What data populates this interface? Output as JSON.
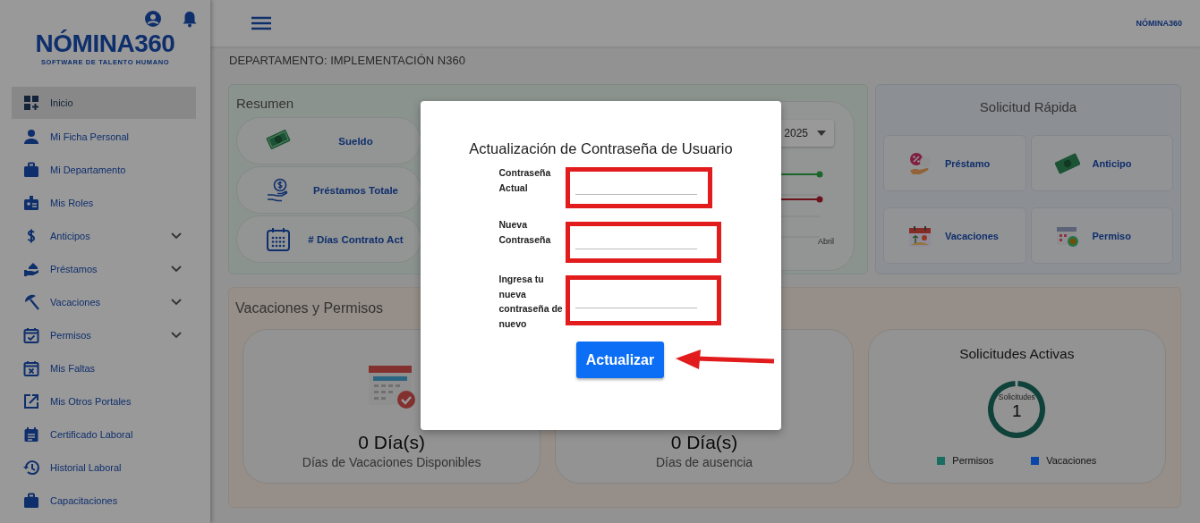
{
  "sidebar": {
    "logo": {
      "name": "NÓMINA360",
      "tagline": "SOFTWARE DE TALENTO HUMANO"
    },
    "items": [
      {
        "label": "Inicio",
        "selected": true,
        "has_submenu": false
      },
      {
        "label": "Mi Ficha Personal",
        "selected": false,
        "has_submenu": false
      },
      {
        "label": "Mi Departamento",
        "selected": false,
        "has_submenu": false
      },
      {
        "label": "Mis Roles",
        "selected": false,
        "has_submenu": false
      },
      {
        "label": "Anticipos",
        "selected": false,
        "has_submenu": true
      },
      {
        "label": "Préstamos",
        "selected": false,
        "has_submenu": true
      },
      {
        "label": "Vacaciones",
        "selected": false,
        "has_submenu": true
      },
      {
        "label": "Permisos",
        "selected": false,
        "has_submenu": true
      },
      {
        "label": "Mis Faltas",
        "selected": false,
        "has_submenu": false
      },
      {
        "label": "Mis Otros Portales",
        "selected": false,
        "has_submenu": false
      },
      {
        "label": "Certificado Laboral",
        "selected": false,
        "has_submenu": false
      },
      {
        "label": "Historial Laboral",
        "selected": false,
        "has_submenu": false
      },
      {
        "label": "Capacitaciones",
        "selected": false,
        "has_submenu": false
      }
    ]
  },
  "header": {
    "logo": "NÓMINA360"
  },
  "department": "DEPARTAMENTO: IMPLEMENTACIÓN N360",
  "resumen": {
    "title": "Resumen",
    "rows": [
      {
        "label": "Sueldo"
      },
      {
        "label": "Préstamos Totale"
      },
      {
        "label": "# Días Contrato Act"
      }
    ],
    "chart": {
      "year": "2025",
      "x_label": "Abril"
    }
  },
  "solicitud_rapida": {
    "title": "Solicitud Rápida",
    "items": [
      {
        "label": "Préstamo"
      },
      {
        "label": "Anticipo"
      },
      {
        "label": "Vacaciones"
      },
      {
        "label": "Permiso"
      }
    ]
  },
  "vacaciones_permisos": {
    "title": "Vacaciones y Permisos",
    "cards": [
      {
        "kind": "stat",
        "value": "0 Día(s)",
        "caption": "Días de Vacaciones Disponibles"
      },
      {
        "kind": "stat",
        "value": "0 Día(s)",
        "caption": "Días de ausencia"
      },
      {
        "kind": "donut",
        "title": "Solicitudes Activas",
        "center_label": "Solicitudes",
        "center_value": "1",
        "legend": [
          {
            "label": "Permisos",
            "color": "#1a6e61"
          },
          {
            "label": "Vacaciones",
            "color": "#0b47a8"
          }
        ]
      }
    ]
  },
  "modal": {
    "title": "Actualización de Contraseña de Usuario",
    "fields": [
      {
        "label": "Contraseña Actual",
        "highlighted": true
      },
      {
        "label": "Nueva Contraseña",
        "highlighted": true
      },
      {
        "label": "Ingresa tu nueva contraseña de nuevo",
        "highlighted": true
      }
    ],
    "button": "Actualizar",
    "arrow": true
  }
}
